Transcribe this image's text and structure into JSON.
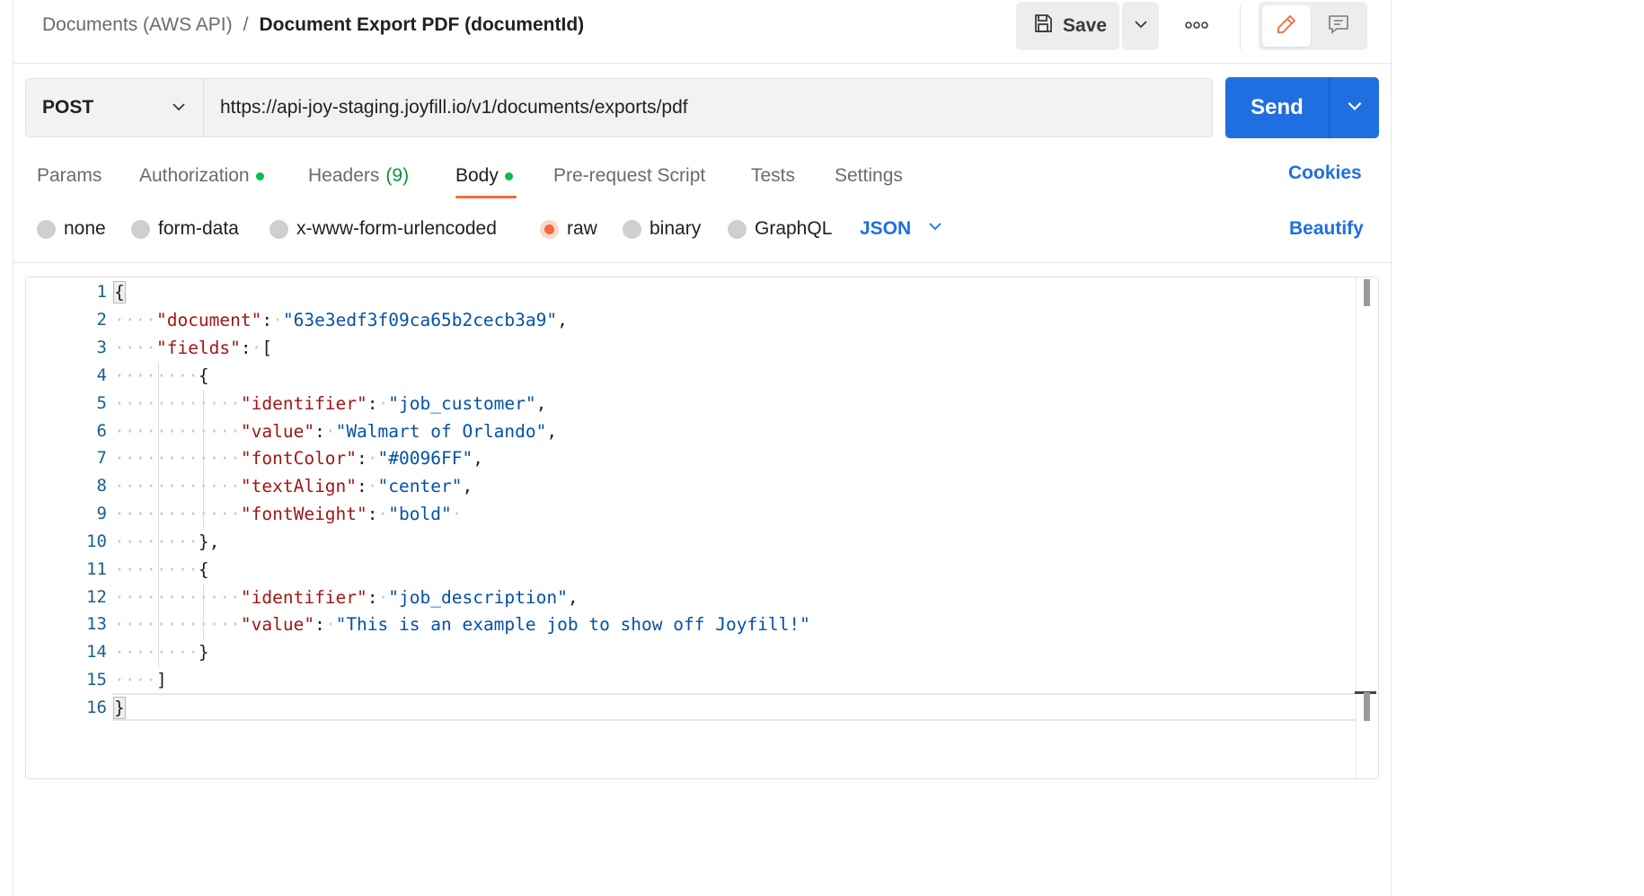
{
  "header": {
    "breadcrumb_parent": "Documents (AWS API)",
    "breadcrumb_separator": "/",
    "breadcrumb_current": "Document Export PDF (documentId)",
    "save_label": "Save"
  },
  "request": {
    "method": "POST",
    "url": "https://api-joy-staging.joyfill.io/v1/documents/exports/pdf",
    "send_label": "Send"
  },
  "tabs": {
    "params": "Params",
    "authorization": "Authorization",
    "headers": "Headers",
    "headers_count": "(9)",
    "body": "Body",
    "prerequest": "Pre-request Script",
    "tests": "Tests",
    "settings": "Settings",
    "active": "Body",
    "cookies": "Cookies"
  },
  "body_types": {
    "none": "none",
    "form_data": "form-data",
    "urlencoded": "x-www-form-urlencoded",
    "raw": "raw",
    "binary": "binary",
    "graphql": "GraphQL",
    "selected": "raw",
    "language": "JSON",
    "beautify": "Beautify"
  },
  "editor": {
    "line_numbers": [
      "1",
      "2",
      "3",
      "4",
      "5",
      "6",
      "7",
      "8",
      "9",
      "10",
      "11",
      "12",
      "13",
      "14",
      "15",
      "16"
    ],
    "tokens": {
      "document_key": "\"document\"",
      "document_val": "\"63e3edf3f09ca65b2cecb3a9\"",
      "fields_key": "\"fields\"",
      "identifier_key": "\"identifier\"",
      "value_key": "\"value\"",
      "fontColor_key": "\"fontColor\"",
      "textAlign_key": "\"textAlign\"",
      "fontWeight_key": "\"fontWeight\"",
      "f1_identifier": "\"job_customer\"",
      "f1_value": "\"Walmart of Orlando\"",
      "f1_fontColor": "\"#0096FF\"",
      "f1_textAlign": "\"center\"",
      "f1_fontWeight": "\"bold\"",
      "f2_identifier": "\"job_description\"",
      "f2_value": "\"This is an example job to show off Joyfill!\""
    }
  },
  "colors": {
    "accent_blue": "#1f6fe0",
    "tab_underline": "#f26b3a",
    "status_dot": "#0cbb52",
    "json_key": "#a31515",
    "json_string": "#0451a5",
    "line_number": "#1a5f8a"
  }
}
